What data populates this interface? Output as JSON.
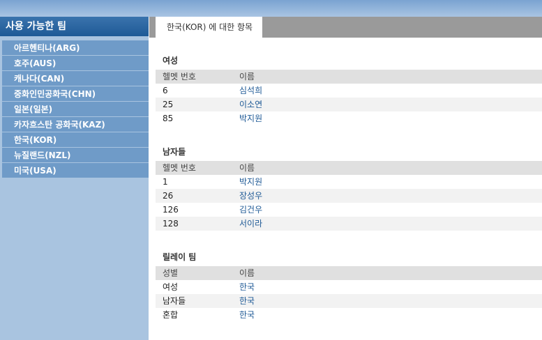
{
  "sidebar": {
    "header": "사용 가능한 팀",
    "teams": [
      "아르헨티나(ARG)",
      "호주(AUS)",
      "캐나다(CAN)",
      "중화인민공화국(CHN)",
      "일본(일본)",
      "카자흐스탄 공화국(KAZ)",
      "한국(KOR)",
      "뉴질랜드(NZL)",
      "미국(USA)"
    ]
  },
  "main": {
    "tab_label": "한국(KOR) 에 대한 항목",
    "women": {
      "title": "여성",
      "headers": [
        "헬멧 번호",
        "이름"
      ],
      "rows": [
        [
          "6",
          "심석희"
        ],
        [
          "25",
          "이소연"
        ],
        [
          "85",
          "박지원"
        ]
      ]
    },
    "men": {
      "title": "남자들",
      "headers": [
        "헬멧 번호",
        "이름"
      ],
      "rows": [
        [
          "1",
          "박지원"
        ],
        [
          "26",
          "장성우"
        ],
        [
          "126",
          "김건우"
        ],
        [
          "128",
          "서이라"
        ]
      ]
    },
    "relay": {
      "title": "릴레이 팀",
      "headers": [
        "성별",
        "이름"
      ],
      "rows": [
        [
          "여성",
          "한국"
        ],
        [
          "남자들",
          "한국"
        ],
        [
          "혼합",
          "한국"
        ]
      ]
    }
  }
}
